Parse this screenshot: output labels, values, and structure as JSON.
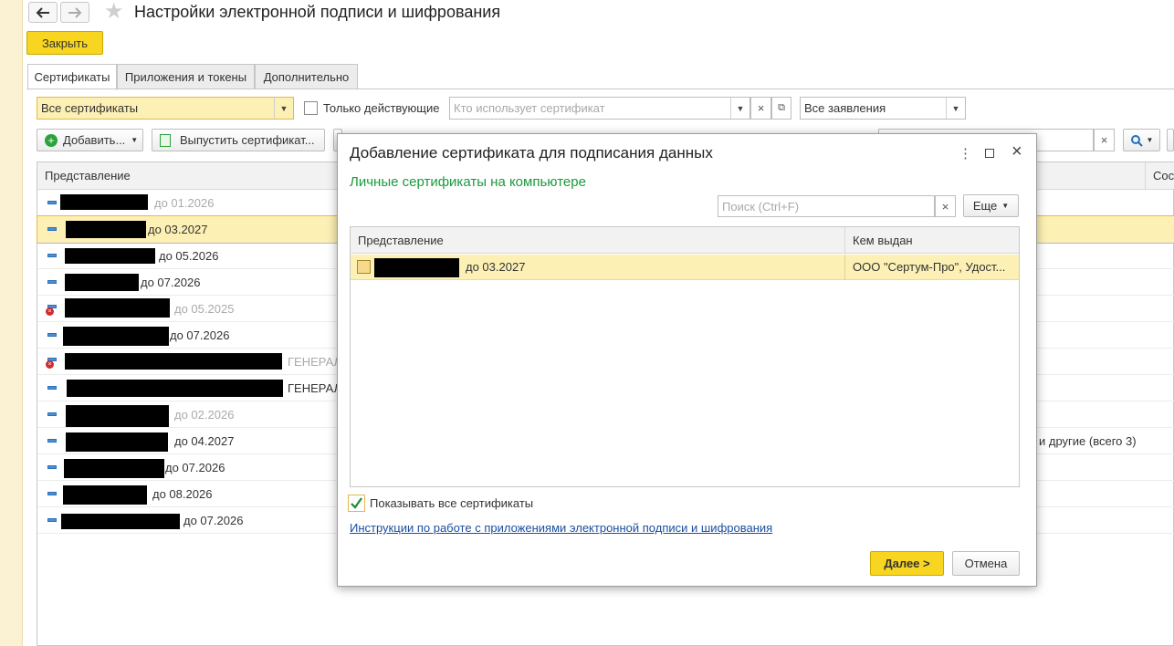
{
  "window": {
    "title": "Настройки электронной подписи и шифрования",
    "close_label": "Закрыть"
  },
  "tabs": [
    {
      "label": "Сертификаты",
      "active": true
    },
    {
      "label": "Приложения и токены",
      "active": false
    },
    {
      "label": "Дополнительно",
      "active": false
    }
  ],
  "filters": {
    "certs_select": "Все сертификаты",
    "only_active_label": "Только действующие",
    "user_placeholder": "Кто использует сертификат",
    "applications_select": "Все заявления"
  },
  "toolbar": {
    "add_label": "Добавить...",
    "issue_label": "Выпустить сертификат..."
  },
  "list": {
    "col_presentation": "Представление",
    "col_right": "Сос",
    "right_note": "и другие (всего 3)",
    "rows": [
      {
        "text": "до 01.2026",
        "expired": true,
        "error": false,
        "selected": false
      },
      {
        "text": "до 03.2027",
        "expired": false,
        "error": false,
        "selected": true
      },
      {
        "text": "до 05.2026",
        "expired": false,
        "error": false,
        "selected": false
      },
      {
        "text": "до 07.2026",
        "expired": false,
        "error": false,
        "selected": false
      },
      {
        "text": "до 05.2025",
        "expired": true,
        "error": true,
        "selected": false
      },
      {
        "text": "до 07.2026",
        "expired": false,
        "error": false,
        "selected": false
      },
      {
        "text": "ГЕНЕРАЛ",
        "expired": true,
        "error": true,
        "selected": false
      },
      {
        "text": "ГЕНЕРАЛ",
        "expired": false,
        "error": false,
        "selected": false
      },
      {
        "text": "до 02.2026",
        "expired": true,
        "error": false,
        "selected": false
      },
      {
        "text": "до 04.2027",
        "expired": false,
        "error": false,
        "selected": false
      },
      {
        "text": "до 07.2026",
        "expired": false,
        "error": false,
        "selected": false
      },
      {
        "text": "до 08.2026",
        "expired": false,
        "error": false,
        "selected": false
      },
      {
        "text": "до 07.2026",
        "expired": false,
        "error": false,
        "selected": false
      }
    ]
  },
  "dialog": {
    "title": "Добавление сертификата для подписания данных",
    "subtitle": "Личные сертификаты на компьютере",
    "search_placeholder": "Поиск (Ctrl+F)",
    "more_label": "Еще",
    "col_presentation": "Представление",
    "col_issuer": "Кем выдан",
    "rows": [
      {
        "presentation": "до 03.2027",
        "issuer": "ООО \"Сертум-Про\", Удост..."
      }
    ],
    "show_all_label": "Показывать все сертификаты",
    "show_all_checked": true,
    "instructions_link": "Инструкции по работе с приложениями электронной подписи и шифрования",
    "next_label": "Далее >",
    "cancel_label": "Отмена"
  },
  "colors": {
    "accent_yellow": "#f7d520",
    "selection": "#fdf0b4",
    "subtitle_green": "#1a9a3d",
    "link_blue": "#1b4fa0"
  }
}
